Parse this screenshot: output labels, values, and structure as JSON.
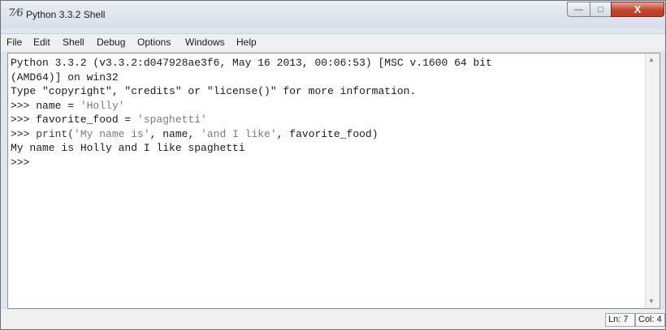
{
  "window": {
    "title": "Python 3.3.2 Shell",
    "app_icon": "7⁄6",
    "controls": {
      "minimize": "—",
      "maximize": "□",
      "close": "X"
    }
  },
  "menu": {
    "items": [
      "File",
      "Edit",
      "Shell",
      "Debug",
      "Options",
      "Windows",
      "Help"
    ]
  },
  "shell": {
    "line1": "Python 3.3.2 (v3.3.2:d047928ae3f6, May 16 2013, 00:06:53) [MSC v.1600 64 bit",
    "line2": "(AMD64)] on win32",
    "line3": "Type \"copyright\", \"credits\" or \"license()\" for more information.",
    "prompt": ">>> ",
    "cmd1_code": "name = ",
    "cmd1_str": "'Holly'",
    "cmd2_code": "favorite_food = ",
    "cmd2_str": "'spaghetti'",
    "cmd3_kw": "print(",
    "cmd3_str1": "'My name is'",
    "cmd3_mid": ", name, ",
    "cmd3_str2": "'and I like'",
    "cmd3_end": ", favorite_food)",
    "output": "My name is Holly and I like spaghetti",
    "final_prompt": ">>>"
  },
  "scrollbar": {
    "up": "▲",
    "down": "▼"
  },
  "status": {
    "line": "Ln: 7",
    "col": "Col: 4"
  }
}
